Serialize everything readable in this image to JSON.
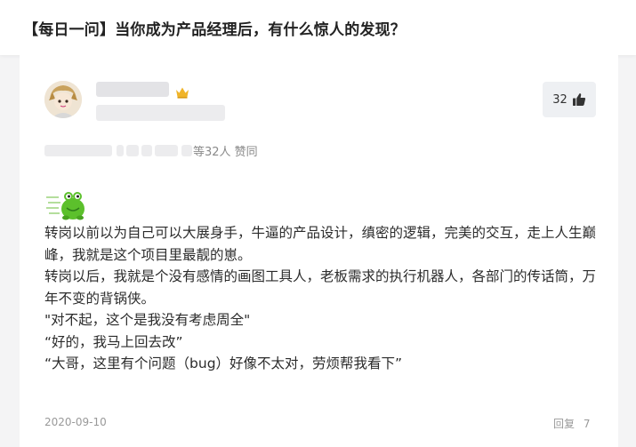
{
  "page": {
    "title": "【每日一问】当你成为产品经理后，有什么惊人的发现？"
  },
  "answer": {
    "like_count": "32",
    "agree_text": "等32人 赞同",
    "content": [
      "转岗以前以为自己可以大展身手，牛逼的产品设计，缜密的逻辑，完美的交互，走上人生巅峰，我就是这个项目里最靓的崽。",
      "转岗以后，我就是个没有感情的画图工具人，老板需求的执行机器人，各部门的传话筒，万年不变的背锅侠。",
      "\"对不起，这个是我没有考虑周全\"",
      "“好的，我马上回去改”",
      "“大哥，这里有个问题（bug）好像不太对，劳烦帮我看下”"
    ],
    "date": "2020-09-10",
    "reply_label": "回复",
    "reply_count": "7"
  },
  "icons": {
    "crown": "crown-icon",
    "like": "thumbs-up-icon",
    "emoji": "frog-emoji"
  },
  "colors": {
    "crown": "#f0b429",
    "frog": "#5cc02c"
  }
}
